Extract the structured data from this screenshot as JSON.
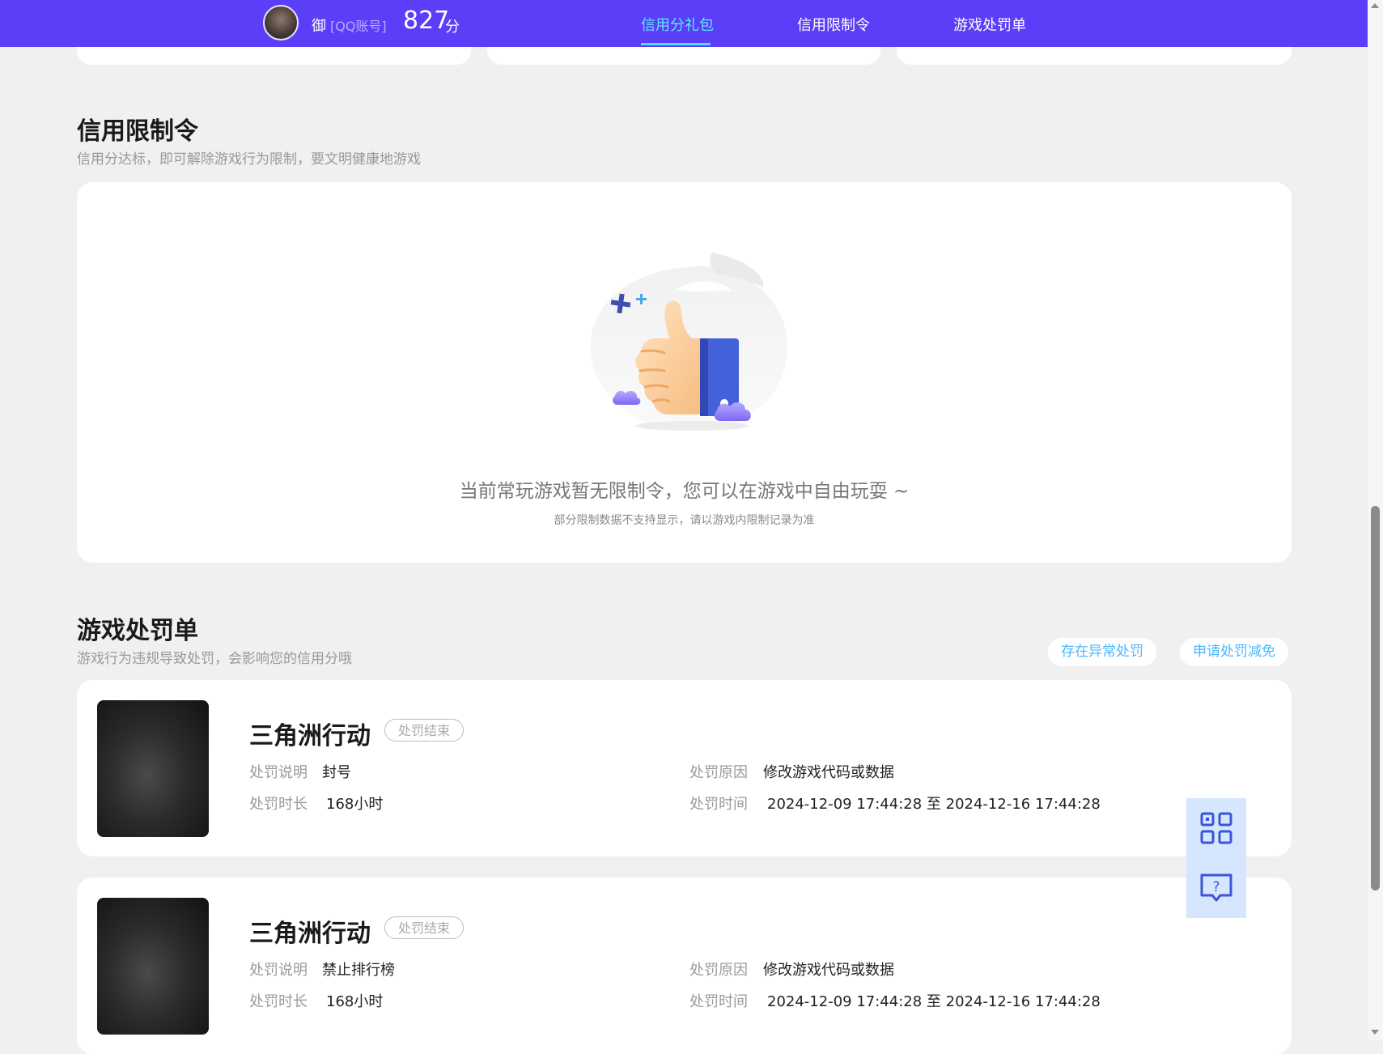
{
  "header": {
    "nickname": "御",
    "account_type": "[QQ账号]",
    "score": "827",
    "score_unit": "分",
    "nav": [
      {
        "label": "信用分礼包",
        "active": true
      },
      {
        "label": "信用限制令",
        "active": false
      },
      {
        "label": "游戏处罚单",
        "active": false
      }
    ],
    "accent_color": "#5a3ef8",
    "active_color": "#5fe6ff"
  },
  "restriction": {
    "title": "信用限制令",
    "subtitle": "信用分达标，即可解除游戏行为限制，要文明健康地游戏",
    "empty_title": "当前常玩游戏暂无限制令，您可以在游戏中自由玩耍 ~",
    "empty_note": "部分限制数据不支持显示，请以游戏内限制记录为准",
    "illustration_icon": "thumbs-up-icon"
  },
  "penalties": {
    "title": "游戏处罚单",
    "subtitle": "游戏行为违规导致处罚，会影响您的信用分哦",
    "action_abnormal": "存在异常处罚",
    "action_reduce": "申请处罚减免",
    "labels": {
      "desc": "处罚说明",
      "duration": "处罚时长",
      "reason": "处罚原因",
      "time": "处罚时间"
    },
    "items": [
      {
        "game": "三角洲行动",
        "status": "处罚结束",
        "desc": "封号",
        "duration": "168小时",
        "reason": "修改游戏代码或数据",
        "time": "2024-12-09 17:44:28 至 2024-12-16 17:44:28"
      },
      {
        "game": "三角洲行动",
        "status": "处罚结束",
        "desc": "禁止排行榜",
        "duration": "168小时",
        "reason": "修改游戏代码或数据",
        "time": "2024-12-09 17:44:28 至 2024-12-16 17:44:28"
      }
    ]
  },
  "tools": {
    "qr_icon": "qr-code-icon",
    "help_icon": "help-chat-icon"
  }
}
